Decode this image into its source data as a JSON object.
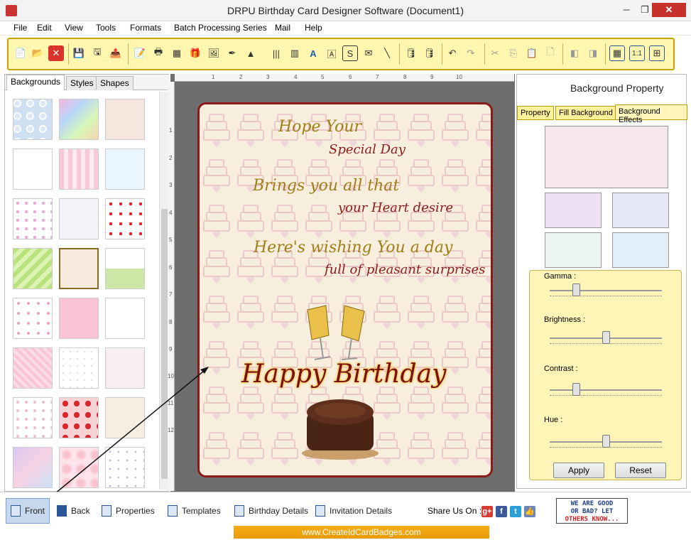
{
  "window": {
    "title": "DRPU Birthday Card Designer Software (Document1)",
    "min": "─",
    "max": "❐",
    "close": "✕"
  },
  "menu": [
    "File",
    "Edit",
    "View",
    "Tools",
    "Formats",
    "Batch Processing Series",
    "Mail",
    "Help"
  ],
  "toolbar_icons": [
    "new-icon",
    "open-icon",
    "close-doc-icon",
    "save-icon",
    "save-as-icon",
    "export-icon",
    "print-preview-icon",
    "print-icon",
    "print-multiple-icon",
    "gift-icon",
    "image-icon",
    "pen-icon",
    "shapes-icon",
    "barcode-icon",
    "barcode2-icon",
    "text-icon",
    "word-art-icon",
    "signature-icon",
    "email-icon",
    "line-icon",
    "db-icon",
    "db2-icon",
    "undo-icon",
    "redo-icon",
    "cut-icon",
    "copy-icon",
    "paste-icon",
    "delete-icon",
    "bring-front-icon",
    "send-back-icon",
    "grid-icon",
    "actual-size-icon",
    "fit-icon"
  ],
  "left_tabs": [
    "Backgrounds",
    "Styles",
    "Shapes"
  ],
  "ruler_h": [
    "1",
    "2",
    "3",
    "4",
    "5",
    "6",
    "7",
    "8",
    "9",
    "10"
  ],
  "ruler_v": [
    "1",
    "2",
    "3",
    "4",
    "5",
    "6",
    "7",
    "8",
    "9",
    "10",
    "11",
    "12"
  ],
  "card": {
    "line1": "Hope Your",
    "line2": "Special Day",
    "line3": "Brings you all that",
    "line4": "your Heart desire",
    "line5": "Here's wishing You a day",
    "line6": "full of pleasant surprises",
    "headline": "Happy Birthday"
  },
  "right_panel": {
    "title": "Background Property",
    "tabs": [
      "Property",
      "Fill Background",
      "Background Effects"
    ],
    "sliders": [
      {
        "label": "Gamma :",
        "value": 0.23
      },
      {
        "label": "Brightness :",
        "value": 0.5
      },
      {
        "label": "Contrast :",
        "value": 0.23
      },
      {
        "label": "Hue :",
        "value": 0.5
      }
    ],
    "apply": "Apply",
    "reset": "Reset"
  },
  "bottom": {
    "front": "Front",
    "back": "Back",
    "properties": "Properties",
    "templates": "Templates",
    "birthday_details": "Birthday Details",
    "invitation_details": "Invitation Details",
    "share": "Share Us On :"
  },
  "social": [
    {
      "name": "google-plus-icon",
      "glyph": "g+",
      "color": "#d73d32"
    },
    {
      "name": "facebook-icon",
      "glyph": "f",
      "color": "#3b5998"
    },
    {
      "name": "twitter-icon",
      "glyph": "t",
      "color": "#2a9fd6"
    },
    {
      "name": "like-icon",
      "glyph": "👍",
      "color": "#6b87b7"
    }
  ],
  "badge": {
    "line1": "WE ARE GOOD",
    "line2": "OR BAD? LET",
    "line3": "OTHERS KNOW..."
  },
  "footer": "www.CreateIdCardBadges.com",
  "colors": {
    "accent": "#c8a200",
    "card_border": "#8b1a1a",
    "toolbar_bg": "#fff7b0"
  }
}
